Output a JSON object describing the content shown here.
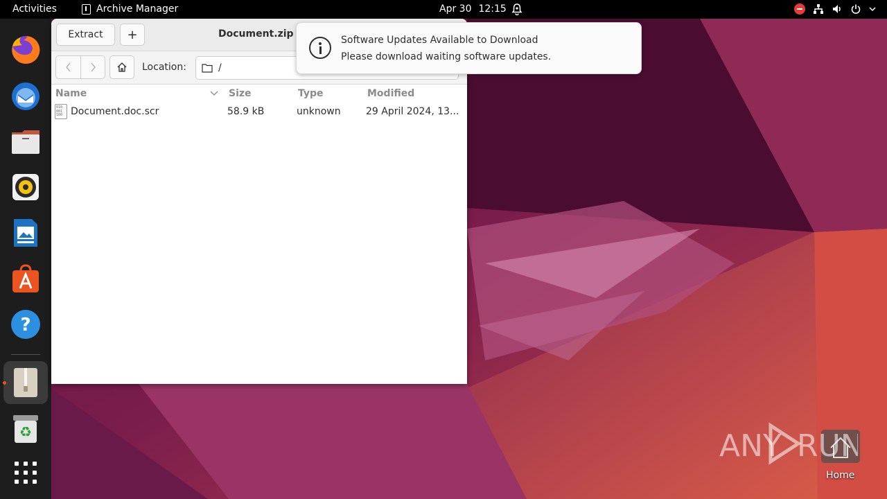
{
  "topbar": {
    "activities": "Activities",
    "app_name": "Archive Manager",
    "date": "Apr 30",
    "time": "12:15"
  },
  "dock": {
    "items": [
      {
        "name": "firefox-icon"
      },
      {
        "name": "thunderbird-icon"
      },
      {
        "name": "files-icon"
      },
      {
        "name": "rhythmbox-icon"
      },
      {
        "name": "libreoffice-writer-icon"
      },
      {
        "name": "app-center-icon"
      },
      {
        "name": "help-icon"
      },
      {
        "name": "archive-manager-icon"
      },
      {
        "name": "trash-icon"
      },
      {
        "name": "show-apps-icon"
      }
    ]
  },
  "window": {
    "title": "Document.zip",
    "extract_label": "Extract",
    "add_label": "+",
    "location_label": "Location:",
    "location_value": "/",
    "columns": {
      "name": "Name",
      "size": "Size",
      "type": "Type",
      "modified": "Modified"
    },
    "files": [
      {
        "name": "Document.doc.scr",
        "size": "58.9 kB",
        "type": "unknown",
        "modified": "29 April 2024, 13..."
      }
    ]
  },
  "notification": {
    "title": "Software Updates Available to Download",
    "body": "Please download waiting software updates."
  },
  "desktop": {
    "home_label": "Home",
    "watermark": "ANY RUN"
  },
  "colors": {
    "accent": "#e95420",
    "topbar": "#000000",
    "dock": "#1d1d1d"
  }
}
